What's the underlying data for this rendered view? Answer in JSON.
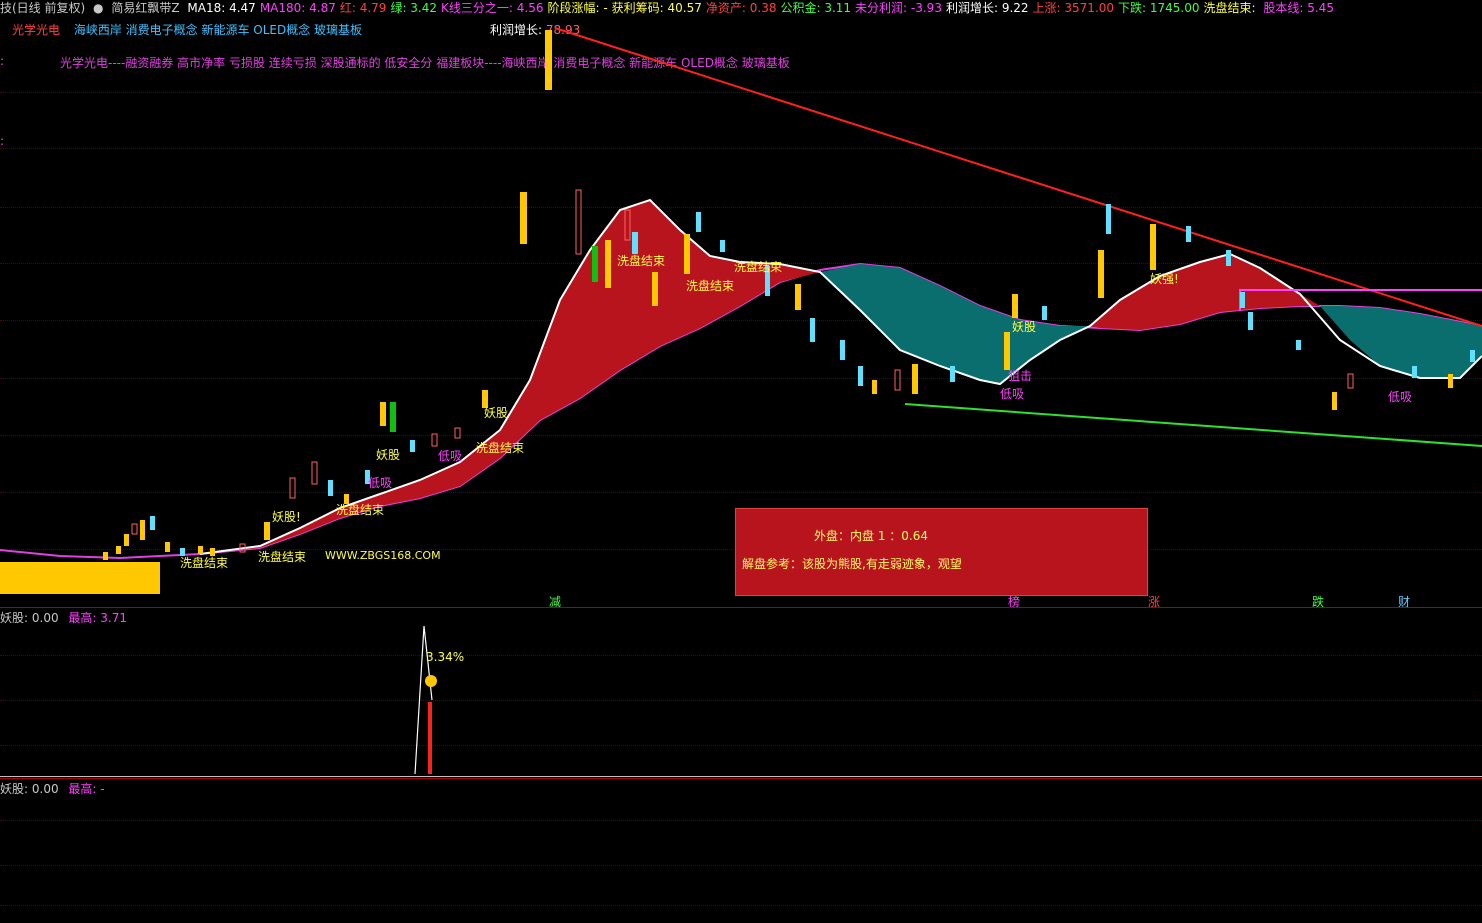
{
  "header": {
    "period": "技(日线 前复权)",
    "indicator_name": "简易红飘带Z",
    "items": [
      {
        "label": "MA18:",
        "value": "4.47",
        "color": "#ffffff"
      },
      {
        "label": "MA180:",
        "value": "4.87",
        "color": "#ff40ff"
      },
      {
        "label": "红:",
        "value": "4.79",
        "color": "#ff4040"
      },
      {
        "label": "绿:",
        "value": "3.42",
        "color": "#40ff40"
      },
      {
        "label": "K线三分之一:",
        "value": "4.56",
        "color": "#ff40ff"
      },
      {
        "label": "阶段涨幅:",
        "value": "-",
        "color": "#ffff40"
      },
      {
        "label": "获利筹码:",
        "value": "40.57",
        "color": "#ffff40"
      },
      {
        "label": "净资产:",
        "value": "0.38",
        "color": "#ff4040"
      },
      {
        "label": "公积金:",
        "value": "3.11",
        "color": "#40ff40"
      },
      {
        "label": "未分利润:",
        "value": "-3.93",
        "color": "#ff40ff"
      },
      {
        "label": "利润增长:",
        "value": "9.22",
        "color": "#ffffff"
      },
      {
        "label": "上涨:",
        "value": "3571.00",
        "color": "#ff4040"
      },
      {
        "label": "下跌:",
        "value": "1745.00",
        "color": "#40ff40"
      },
      {
        "label": "洗盘结束:",
        "value": "",
        "color": "#ffff40"
      },
      {
        "label": "股本线:",
        "value": "5.45",
        "color": "#ff40ff"
      }
    ]
  },
  "tags": {
    "sector": "光学光电",
    "concepts": "海峡西岸 消费电子概念 新能源车 OLED概念 玻璃基板",
    "line2": "光学光电----融资融券 高市净率 亏损股 连续亏损 深股通标的 低安全分 福建板块----海峡西岸 消费电子概念 新能源车 OLED概念 玻璃基板",
    "profit_label": "利润增长:",
    "profit_value": "78.93"
  },
  "signals": {
    "xipan": "洗盘结束",
    "yaogu": "妖股",
    "yaogu2": "妖股!",
    "yaoqiang": "妖强!",
    "dixi": "低吸",
    "zhuangji": "狙击",
    "website": "WWW.ZBGS168.COM"
  },
  "infobox": {
    "ratio": "外盘：内盘  1 ：0.64",
    "advice": "解盘参考：该股为熊股,有走弱迹象，观望"
  },
  "bottom_markers": [
    {
      "text": "减",
      "color": "#40ff40"
    },
    {
      "text": "榜",
      "color": "#ff40ff"
    },
    {
      "text": "涨",
      "color": "#ff4040"
    },
    {
      "text": "跌",
      "color": "#40ff40"
    },
    {
      "text": "财",
      "color": "#66ccff"
    }
  ],
  "panel2": {
    "label": "妖股:",
    "value": "0.00",
    "max_label": "最高:",
    "max_value": "3.71",
    "pct": "3.34%"
  },
  "panel3": {
    "label": "妖股:",
    "value": "0.00",
    "max_label": "最高:",
    "max_value": "-"
  }
}
